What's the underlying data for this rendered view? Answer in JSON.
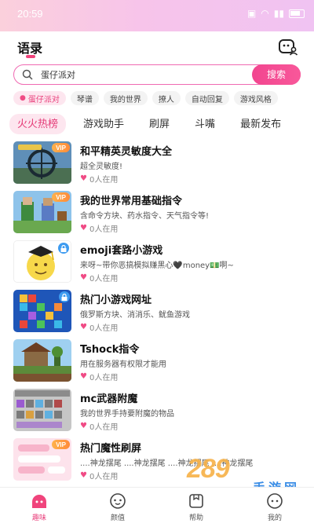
{
  "status_bar": {
    "time": "20:59"
  },
  "header": {
    "title": "语录"
  },
  "search": {
    "value": "蛋仔派对",
    "button_label": "搜索"
  },
  "tags": [
    "蛋仔派对",
    "琴谱",
    "我的世界",
    "撩人",
    "自动回复",
    "游戏风格"
  ],
  "tabs": [
    "火火热榜",
    "游戏助手",
    "刷屏",
    "斗嘴",
    "最新发布"
  ],
  "items": [
    {
      "title": "和平精英灵敏度大全",
      "desc": "超全灵敏度!",
      "users": "0人在用",
      "badge": "VIP"
    },
    {
      "title": "我的世界常用基础指令",
      "desc": "含命令方块、药水指令、天气指令等!",
      "users": "0人在用",
      "badge": "VIP"
    },
    {
      "title": "emoji套路小游戏",
      "desc": "来呀~带你恶搞模拟赚黑心🖤money💵啊~",
      "users": "0人在用",
      "badge": "lock"
    },
    {
      "title": "热门小游戏网址",
      "desc": "俄罗斯方块、消消乐、鱿鱼游戏",
      "users": "0人在用",
      "badge": "lock"
    },
    {
      "title": "Tshock指令",
      "desc": "用在服务器有权限才能用",
      "users": "0人在用",
      "badge": "none"
    },
    {
      "title": "mc武器附魔",
      "desc": "我的世界手持要附魔的物品",
      "users": "0人在用",
      "badge": "none"
    },
    {
      "title": "热门魔性刷屏",
      "desc": "....神龙摆尾 ....神龙摆尾 ....神龙摆尾 ....神龙摆尾",
      "users": "0人在用",
      "badge": "VIP"
    }
  ],
  "vip_label": "VIP",
  "bottom_nav": [
    "趣味",
    "颜值",
    "帮助",
    "我的"
  ],
  "watermark": {
    "logo": "289",
    "sub": "手游网"
  },
  "colors": {
    "accent": "#f0447c",
    "search_border": "#f06ab2",
    "vip": "#ff9a40"
  }
}
